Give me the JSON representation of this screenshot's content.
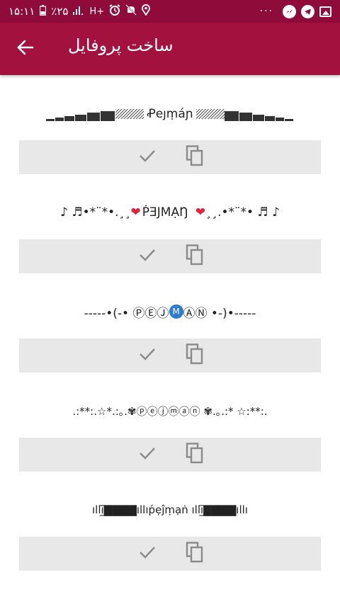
{
  "status_bar": {
    "time": "۱۵:۱۱",
    "battery": "٪۲۵",
    "network": "H+",
    "dots": "···"
  },
  "header": {
    "title": "ساخت پروفایل"
  },
  "nicknames": [
    {
      "text": "Ꝓeյṃáɲ"
    },
    {
      "left": "♪ ♬•*¨*•.¸¸",
      "center": "ṖƎJMẠŊ",
      "right": "¸¸.•*¨*• ♬ ♪"
    },
    {
      "left": "-----•(-• ⓅⒺⒿ",
      "m": "M",
      "right": "ⒶⓃ •-)•-----"
    },
    {
      "text": ".:**:.☆*.:｡.✾ⓟⓔⓙⓜⓐⓝ ✾.｡.:* ☆:**:."
    },
    {
      "text": "ıllı̲̅̅▇̅▇̲̅▇̅▇̅ıllıṕẹĵṃạṅ ıllı̲̅▇̅▇̲̅▇̅▇̅ıllı"
    }
  ],
  "colors": {
    "status_bar": "#8f0b3a",
    "app_bar": "#a3113f",
    "action_bar": "#e8e8e8",
    "icon": "#8a8a8a"
  },
  "icons": {
    "back": "arrow-back-icon",
    "check": "check-icon",
    "copy": "copy-icon"
  }
}
